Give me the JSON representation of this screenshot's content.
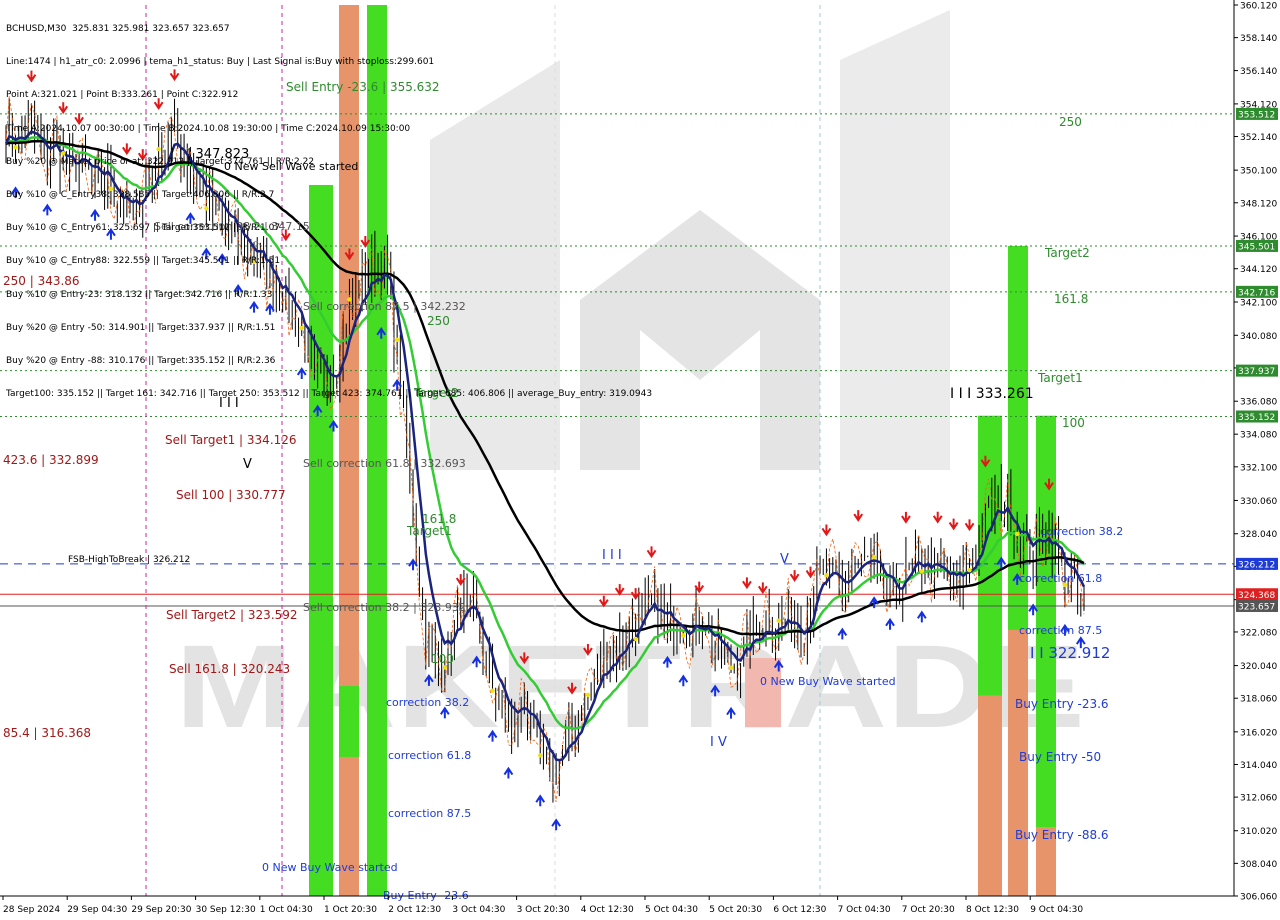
{
  "info_panel": {
    "lines": [
      "BCHUSD,M30  325.831 325.981 323.657 323.657",
      "Line:1474 | h1_atr_c0: 2.0996 | tema_h1_status: Buy | Last Signal is:Buy with stoploss:299.601",
      "Point A:321.021 | Point B:333.261 | Point C:322.912",
      "Time A:2024.10.07 00:30:00 | Time B:2024.10.08 19:30:00 | Time C:2024.10.09 15:30:00",
      "Buy %20 @ Market price or at: 322.912 || Target:374.761 || R/R:2.22",
      "Buy %10 @ C_Entry38: 328.585 || Target:406.806 || R/R:2.7",
      "Buy %10 @ C_Entry61: 325.697 || Target:353.512 || R/R:1.07",
      "Buy %10 @ C_Entry88: 322.559 || Target:345.501 || R/R:1.51",
      "Buy %10 @ Entry-23: 318.132 || Target:342.716 || R/R:1.33",
      "Buy %20 @ Entry -50: 314.901 || Target:337.937 || R/R:1.51",
      "Buy %20 @ Entry -88: 310.176 || Target:335.152 || R/R:2.36",
      "Target100: 335.152 || Target 161: 342.716 || Target 250: 353.512 || Target 423: 374.761 || Target 685: 406.806 || average_Buy_entry: 319.0943"
    ]
  },
  "chart_data": {
    "type": "candlestick",
    "symbol": "BCHUSD,M30",
    "ylim": [
      306.06,
      360.12
    ],
    "y_ticks": [
      "360.120",
      "358.140",
      "356.140",
      "354.120",
      "352.140",
      "350.100",
      "348.120",
      "346.100",
      "344.120",
      "342.100",
      "340.080",
      "338.100",
      "336.080",
      "334.080",
      "332.100",
      "330.060",
      "328.040",
      "326.060",
      "324.040",
      "322.080",
      "320.040",
      "318.060",
      "316.020",
      "314.040",
      "312.060",
      "310.020",
      "308.040",
      "306.060"
    ],
    "x_ticks": [
      "28 Sep 2024",
      "29 Sep 04:30",
      "29 Sep 20:30",
      "30 Sep 12:30",
      "1 Oct 04:30",
      "1 Oct 20:30",
      "2 Oct 12:30",
      "3 Oct 04:30",
      "3 Oct 20:30",
      "4 Oct 12:30",
      "5 Oct 04:30",
      "5 Oct 20:30",
      "6 Oct 12:30",
      "7 Oct 04:30",
      "7 Oct 20:30",
      "8 Oct 12:30",
      "9 Oct 04:30"
    ],
    "close_path": [
      352.8,
      351.9,
      352.5,
      350.8,
      351.6,
      349.9,
      350.6,
      349.2,
      349.8,
      348.1,
      347.3,
      349.2,
      350.4,
      352.6,
      351.2,
      349.4,
      348.1,
      347.2,
      346.0,
      345.3,
      344.6,
      343.5,
      342.4,
      341.3,
      338.2,
      336.8,
      338.1,
      341.6,
      343.2,
      344.4,
      343.8,
      338.0,
      330.2,
      322.0,
      320.0,
      321.3,
      323.9,
      322.8,
      319.5,
      317.4,
      316.1,
      318.2,
      314.4,
      313.6,
      314.5,
      316.8,
      318.4,
      320.6,
      320.9,
      322.2,
      322.8,
      323.9,
      322.4,
      323.1,
      322.2,
      323.0,
      321.2,
      320.0,
      320.8,
      321.9,
      323.0,
      322.4,
      323.1,
      322.2,
      326.0,
      325.5,
      324.5,
      326.2,
      326.4,
      325.0,
      324.0,
      325.5,
      326.5,
      326.0,
      325.2,
      325.0,
      326.0,
      328.4,
      330.2,
      329.5,
      327.8,
      326.8,
      328.5,
      326.5,
      325.0,
      323.657
    ],
    "horizontal_levels": [
      {
        "label": "353.512",
        "value": 353.512,
        "color": "#2e8b2e",
        "style": "dotted"
      },
      {
        "label": "345.501",
        "value": 345.501,
        "color": "#2e8b2e",
        "style": "dotted"
      },
      {
        "label": "342.716",
        "value": 342.716,
        "color": "#2e8b2e",
        "style": "dotted"
      },
      {
        "label": "337.937",
        "value": 337.937,
        "color": "#2e8b2e",
        "style": "dotted"
      },
      {
        "label": "335.152",
        "value": 335.152,
        "color": "#2e8b2e",
        "style": "dotted"
      },
      {
        "label": "326.212",
        "value": 326.212,
        "color": "#1f3bd6",
        "style": "dashed"
      },
      {
        "label": "324.368",
        "value": 324.368,
        "color": "#e02020",
        "style": "solid"
      },
      {
        "label": "323.657",
        "value": 323.657,
        "color": "#555555",
        "style": "solid"
      }
    ],
    "annotations": [
      {
        "text": "Sell Entry -23.6 | 355.632",
        "color": "#2e8b2e"
      },
      {
        "text": "| | | 347.823",
        "color": "#000000"
      },
      {
        "text": "0 New Sell Wave started",
        "color": "#000000"
      },
      {
        "text": "Sell correction 38.2 | 347.15",
        "color": "#555555"
      },
      {
        "text": "250 | 343.86",
        "color": "#a01818"
      },
      {
        "text": "Sell correction 87.5 | 342.232",
        "color": "#555555"
      },
      {
        "text": "250",
        "color": "#2e8b2e"
      },
      {
        "text": "Target2",
        "color": "#2e8b2e"
      },
      {
        "text": "I I I",
        "color": "#000000"
      },
      {
        "text": "Sell Target1 | 334.126",
        "color": "#a01818"
      },
      {
        "text": "423.6 | 332.899",
        "color": "#a01818"
      },
      {
        "text": "V",
        "color": "#000000"
      },
      {
        "text": "Sell correction 61.8 | 332.693",
        "color": "#555555"
      },
      {
        "text": "Sell 100 | 330.777",
        "color": "#a01818"
      },
      {
        "text": "161.8",
        "color": "#2e8b2e"
      },
      {
        "text": "Target1",
        "color": "#2e8b2e"
      },
      {
        "text": "FSB-HighToBreak | 326.212",
        "color": "#000000"
      },
      {
        "text": "Sell Target2 | 323.592",
        "color": "#a01818"
      },
      {
        "text": "Sell correction 38.2 | 323.932",
        "color": "#555555"
      },
      {
        "text": "100",
        "color": "#2e8b2e"
      },
      {
        "text": "Sell 161.8 | 320.243",
        "color": "#a01818"
      },
      {
        "text": "85.4 | 316.368",
        "color": "#a01818"
      },
      {
        "text": "correction 38.2",
        "color": "#1f3bd6"
      },
      {
        "text": "correction 61.8",
        "color": "#1f3bd6"
      },
      {
        "text": "correction 87.5",
        "color": "#1f3bd6"
      },
      {
        "text": "0 New Buy Wave started",
        "color": "#1f3bd6"
      },
      {
        "text": "Buy Entry -23.6",
        "color": "#1f3bd6"
      },
      {
        "text": "I I I",
        "color": "#1f3bd6"
      },
      {
        "text": "V",
        "color": "#1f3bd6"
      },
      {
        "text": "I V",
        "color": "#1f3bd6"
      },
      {
        "text": "0 New Buy Wave started",
        "color": "#1f3bd6"
      },
      {
        "text": "I I I 333.261",
        "color": "#000000"
      },
      {
        "text": "Target2",
        "color": "#2e8b2e"
      },
      {
        "text": "161.8",
        "color": "#2e8b2e"
      },
      {
        "text": "Target1",
        "color": "#2e8b2e"
      },
      {
        "text": "100",
        "color": "#2e8b2e"
      },
      {
        "text": "250",
        "color": "#2e8b2e"
      },
      {
        "text": "correction 38.2",
        "color": "#1f3bd6"
      },
      {
        "text": "correction 61.8",
        "color": "#1f3bd6"
      },
      {
        "text": "correction 87.5",
        "color": "#1f3bd6"
      },
      {
        "text": "I I 322.912",
        "color": "#1f3bd6"
      },
      {
        "text": "Buy Entry -23.6",
        "color": "#1f3bd6"
      },
      {
        "text": "Buy Entry -50",
        "color": "#1f3bd6"
      },
      {
        "text": "Buy Entry -88.6",
        "color": "#1f3bd6"
      }
    ],
    "watermark": "MAKETRADE",
    "colors": {
      "background": "#ffffff",
      "candles": "#000000",
      "tema_blue": "#1a237e",
      "ma_green": "#33cc33",
      "ma_black": "#000000",
      "bar_green": "#44dd22",
      "bar_orange": "#e8946a"
    }
  }
}
